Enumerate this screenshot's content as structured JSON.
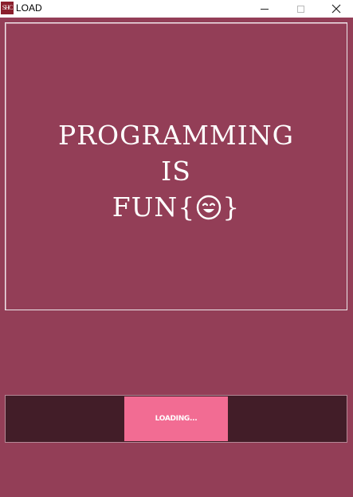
{
  "window": {
    "title": "LOAD",
    "icon_text": "SHC",
    "background": "#933e57"
  },
  "controls": {
    "minimize": "minimize-icon",
    "maximize": "maximize-icon",
    "close": "close-icon"
  },
  "banner": {
    "line1": "PROGRAMMING",
    "line2": "IS",
    "line3_prefix": "FUN{",
    "line3_suffix": "}",
    "emoji_icon": "smiling-face-icon"
  },
  "progress": {
    "label": "LOADING...",
    "track_color": "#421d28",
    "fill_color": "#f26c93"
  }
}
